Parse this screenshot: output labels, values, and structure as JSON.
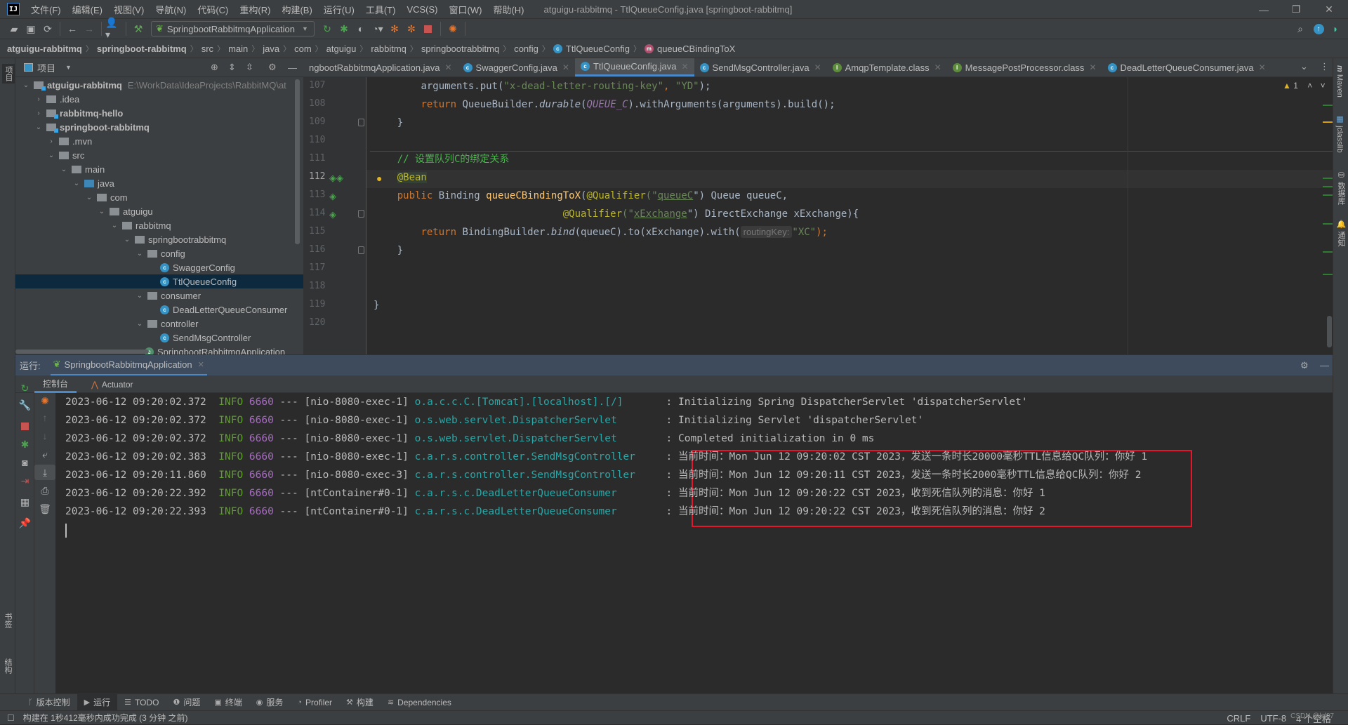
{
  "window": {
    "title": "atguigu-rabbitmq - TtlQueueConfig.java [springboot-rabbitmq]",
    "logo": "IJ",
    "controls": {
      "minimize": "—",
      "maximize": "❐",
      "close": "✕"
    }
  },
  "menu": [
    "文件(F)",
    "编辑(E)",
    "视图(V)",
    "导航(N)",
    "代码(C)",
    "重构(R)",
    "构建(B)",
    "运行(U)",
    "工具(T)",
    "VCS(S)",
    "窗口(W)",
    "帮助(H)"
  ],
  "toolbar": {
    "run_config": "SpringbootRabbitmqApplication"
  },
  "breadcrumb": [
    "atguigu-rabbitmq",
    "springboot-rabbitmq",
    "src",
    "main",
    "java",
    "com",
    "atguigu",
    "rabbitmq",
    "springbootrabbitmq",
    "config",
    "TtlQueueConfig",
    "queueCBindingToX"
  ],
  "project": {
    "header": "项目",
    "side_label": "项目",
    "tree": [
      {
        "label": "atguigu-rabbitmq",
        "path": "E:\\WorkData\\IdeaProjects\\RabbitMQ\\at",
        "depth": 0,
        "chev": "v",
        "type": "module",
        "bold": true
      },
      {
        "label": ".idea",
        "depth": 1,
        "chev": ">",
        "type": "folder"
      },
      {
        "label": "rabbitmq-hello",
        "depth": 1,
        "chev": ">",
        "type": "module",
        "bold": true
      },
      {
        "label": "springboot-rabbitmq",
        "depth": 1,
        "chev": "v",
        "type": "module",
        "bold": true
      },
      {
        "label": ".mvn",
        "depth": 2,
        "chev": ">",
        "type": "folder"
      },
      {
        "label": "src",
        "depth": 2,
        "chev": "v",
        "type": "folder"
      },
      {
        "label": "main",
        "depth": 3,
        "chev": "v",
        "type": "folder"
      },
      {
        "label": "java",
        "depth": 4,
        "chev": "v",
        "type": "source"
      },
      {
        "label": "com",
        "depth": 5,
        "chev": "v",
        "type": "package"
      },
      {
        "label": "atguigu",
        "depth": 6,
        "chev": "v",
        "type": "package"
      },
      {
        "label": "rabbitmq",
        "depth": 7,
        "chev": "v",
        "type": "package"
      },
      {
        "label": "springbootrabbitmq",
        "depth": 8,
        "chev": "v",
        "type": "package"
      },
      {
        "label": "config",
        "depth": 9,
        "chev": "v",
        "type": "package"
      },
      {
        "label": "SwaggerConfig",
        "depth": 10,
        "chev": "",
        "type": "class"
      },
      {
        "label": "TtlQueueConfig",
        "depth": 10,
        "chev": "",
        "type": "class",
        "selected": true
      },
      {
        "label": "consumer",
        "depth": 9,
        "chev": "v",
        "type": "package"
      },
      {
        "label": "DeadLetterQueueConsumer",
        "depth": 10,
        "chev": "",
        "type": "class"
      },
      {
        "label": "controller",
        "depth": 9,
        "chev": "v",
        "type": "package"
      },
      {
        "label": "SendMsgController",
        "depth": 10,
        "chev": "",
        "type": "class"
      },
      {
        "label": "SpringbootRabbitmqApplication",
        "depth": 9,
        "chev": "",
        "type": "app"
      }
    ]
  },
  "tabs": [
    {
      "label": "ngbootRabbitmqApplication.java",
      "badge": "",
      "active": false
    },
    {
      "label": "SwaggerConfig.java",
      "badge": "C",
      "active": false
    },
    {
      "label": "TtlQueueConfig.java",
      "badge": "C",
      "active": true
    },
    {
      "label": "SendMsgController.java",
      "badge": "C",
      "active": false
    },
    {
      "label": "AmqpTemplate.class",
      "badge": "I",
      "active": false
    },
    {
      "label": "MessagePostProcessor.class",
      "badge": "I",
      "active": false
    },
    {
      "label": "DeadLetterQueueConsumer.java",
      "badge": "C",
      "active": false
    }
  ],
  "editor": {
    "warnings": "1",
    "line_numbers": [
      "107",
      "108",
      "109",
      "110",
      "111",
      "112",
      "113",
      "114",
      "115",
      "116",
      "117",
      "118",
      "119",
      "120"
    ],
    "current_line": "112",
    "code": {
      "l107": {
        "a": "arguments.put(",
        "s1": "\"x-dead-letter-routing-key\"",
        "c": ", ",
        "s2": "\"YD\"",
        "e": ");"
      },
      "l108": {
        "kw": "return ",
        "a": "QueueBuilder.",
        "m": "durable",
        "p": "(",
        "k": "QUEUE_C",
        "e": ").withArguments(arguments).build();"
      },
      "l109": "}",
      "l111": "// 设置队列C的绑定关系",
      "l112": "@Bean",
      "l113": {
        "kw": "public ",
        "t": "Binding ",
        "fn": "queueCBindingToX",
        "p": "(",
        "ann": "@Qualifier",
        "o": "(\"",
        "s": "queueC",
        "c": "\") Queue queueC,"
      },
      "l114": {
        "ann": "@Qualifier",
        "o": "(\"",
        "s": "xExchange",
        "c": "\") DirectExchange xExchange){"
      },
      "l115": {
        "kw": "return ",
        "a": "BindingBuilder.",
        "m": "bind",
        "b": "(queueC).to(xExchange).with(",
        "hint": "routingKey:",
        "s": "\"XC\"",
        "e": ");"
      },
      "l116": "}",
      "l119": "}"
    }
  },
  "right_sidebar": [
    "Maven",
    "jclasslib",
    "数据库",
    "通知"
  ],
  "run": {
    "label": "运行:",
    "tab": "SpringbootRabbitmqApplication",
    "subtabs": [
      "控制台",
      "Actuator"
    ],
    "logs": [
      {
        "ts": "2023-06-12 09:20:02.372",
        "level": "INFO",
        "pid": "6660",
        "sep": "---",
        "thread": "[nio-8080-exec-1]",
        "logger": "o.a.c.c.C.[Tomcat].[localhost].[/]      ",
        "msg": ": Initializing Spring DispatcherServlet 'dispatcherServlet'"
      },
      {
        "ts": "2023-06-12 09:20:02.372",
        "level": "INFO",
        "pid": "6660",
        "sep": "---",
        "thread": "[nio-8080-exec-1]",
        "logger": "o.s.web.servlet.DispatcherServlet       ",
        "msg": ": Initializing Servlet 'dispatcherServlet'"
      },
      {
        "ts": "2023-06-12 09:20:02.372",
        "level": "INFO",
        "pid": "6660",
        "sep": "---",
        "thread": "[nio-8080-exec-1]",
        "logger": "o.s.web.servlet.DispatcherServlet       ",
        "msg": ": Completed initialization in 0 ms"
      },
      {
        "ts": "2023-06-12 09:20:02.383",
        "level": "INFO",
        "pid": "6660",
        "sep": "---",
        "thread": "[nio-8080-exec-1]",
        "logger": "c.a.r.s.controller.SendMsgController    ",
        "msg": ": 当前时间：Mon Jun 12 09:20:02 CST 2023，发送一条时长20000毫秒TTL信息给QC队列：你好 1"
      },
      {
        "ts": "2023-06-12 09:20:11.860",
        "level": "INFO",
        "pid": "6660",
        "sep": "---",
        "thread": "[nio-8080-exec-3]",
        "logger": "c.a.r.s.controller.SendMsgController    ",
        "msg": ": 当前时间：Mon Jun 12 09:20:11 CST 2023，发送一条时长2000毫秒TTL信息给QC队列：你好 2"
      },
      {
        "ts": "2023-06-12 09:20:22.392",
        "level": "INFO",
        "pid": "6660",
        "sep": "---",
        "thread": "[ntContainer#0-1]",
        "logger": "c.a.r.s.c.DeadLetterQueueConsumer       ",
        "msg": ": 当前时间：Mon Jun 12 09:20:22 CST 2023，收到死信队列的消息：你好 1"
      },
      {
        "ts": "2023-06-12 09:20:22.393",
        "level": "INFO",
        "pid": "6660",
        "sep": "---",
        "thread": "[ntContainer#0-1]",
        "logger": "c.a.r.s.c.DeadLetterQueueConsumer       ",
        "msg": ": 当前时间：Mon Jun 12 09:20:22 CST 2023，收到死信队列的消息：你好 2"
      }
    ]
  },
  "left_bottom_labels": [
    "书签",
    "结构"
  ],
  "bottom_tabs": [
    "版本控制",
    "运行",
    "TODO",
    "问题",
    "终端",
    "服务",
    "Profiler",
    "构建",
    "Dependencies"
  ],
  "status": {
    "message": "构建在 1秒412毫秒内成功完成 (3 分钟 之前)",
    "line_sep": "CRLF",
    "encoding": "UTF-8",
    "indent": "4 个空格",
    "watermark": "CSDN @lsl07"
  },
  "colors": {
    "accent": "#4a88c7",
    "highlight_box": "#e3162b",
    "log_level": "#5e9f2c",
    "pid": "#a66cc0",
    "logger": "#2aa6a6"
  }
}
